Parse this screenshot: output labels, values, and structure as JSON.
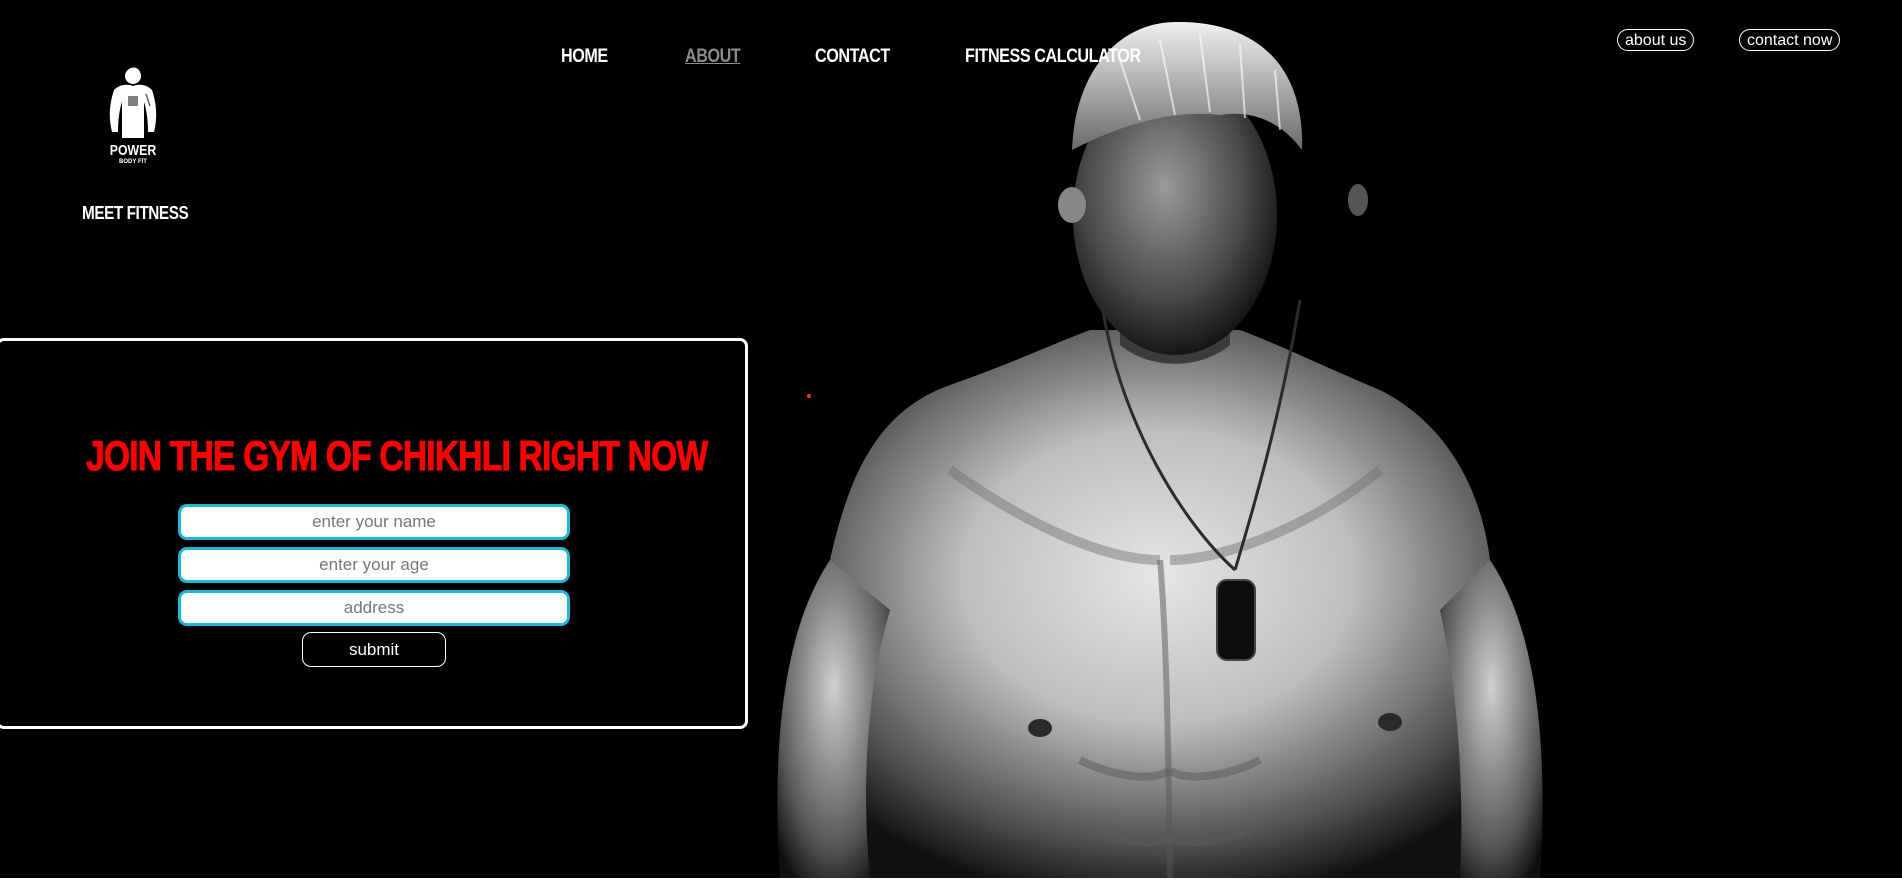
{
  "brand": {
    "logo_name": "POWER",
    "logo_sub": "BODY FIT",
    "tagline": "MEET FITNESS"
  },
  "nav": {
    "items": [
      {
        "label": "HOME",
        "active": false
      },
      {
        "label": "ABOUT",
        "active": true
      },
      {
        "label": "CONTACT",
        "active": false
      },
      {
        "label": "FITNESS CALCULATOR",
        "active": false
      }
    ],
    "about_button": "about us",
    "contact_button": "contact now"
  },
  "form": {
    "title": "JOIN THE GYM OF CHIKHLI RIGHT NOW",
    "name_placeholder": "enter your name",
    "age_placeholder": "enter your age",
    "address_placeholder": "address",
    "submit_label": "submit"
  },
  "colors": {
    "background": "#000000",
    "accent": "#ff0000",
    "field_border": "#1fb6d8",
    "active_nav": "#8c8c8c"
  },
  "icons": {
    "logo": "bodybuilder-silhouette-icon"
  }
}
